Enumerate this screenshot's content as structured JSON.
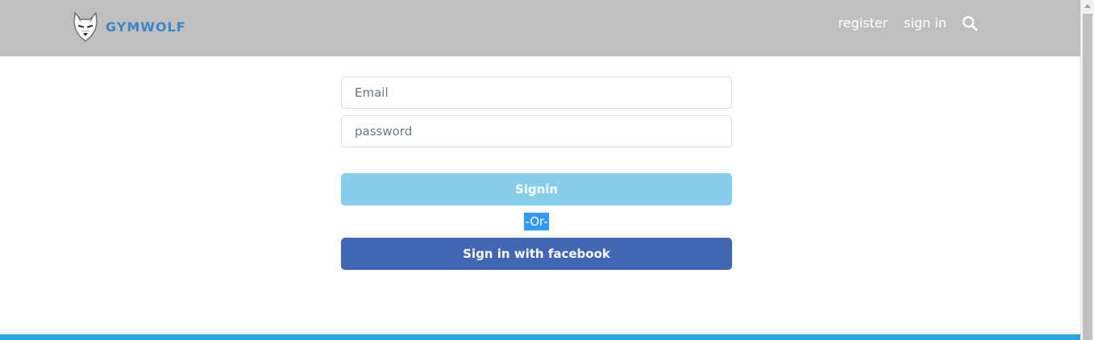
{
  "navbar": {
    "brand_name": "GYMWOLF",
    "links": [
      {
        "label": "register"
      },
      {
        "label": "sign in"
      }
    ],
    "search_icon": "search-icon",
    "background": "#bfbfbf",
    "brand_color": "#3b86c8"
  },
  "signin_form": {
    "email_placeholder": "Email",
    "password_placeholder": "password",
    "signin_label": "Signin",
    "divider_label": "-Or-",
    "facebook_label": "Sign in with facebook",
    "signin_color": "#87ceeb",
    "facebook_color": "#4267b2"
  },
  "footer": {
    "strip_color": "#29a4e0"
  }
}
